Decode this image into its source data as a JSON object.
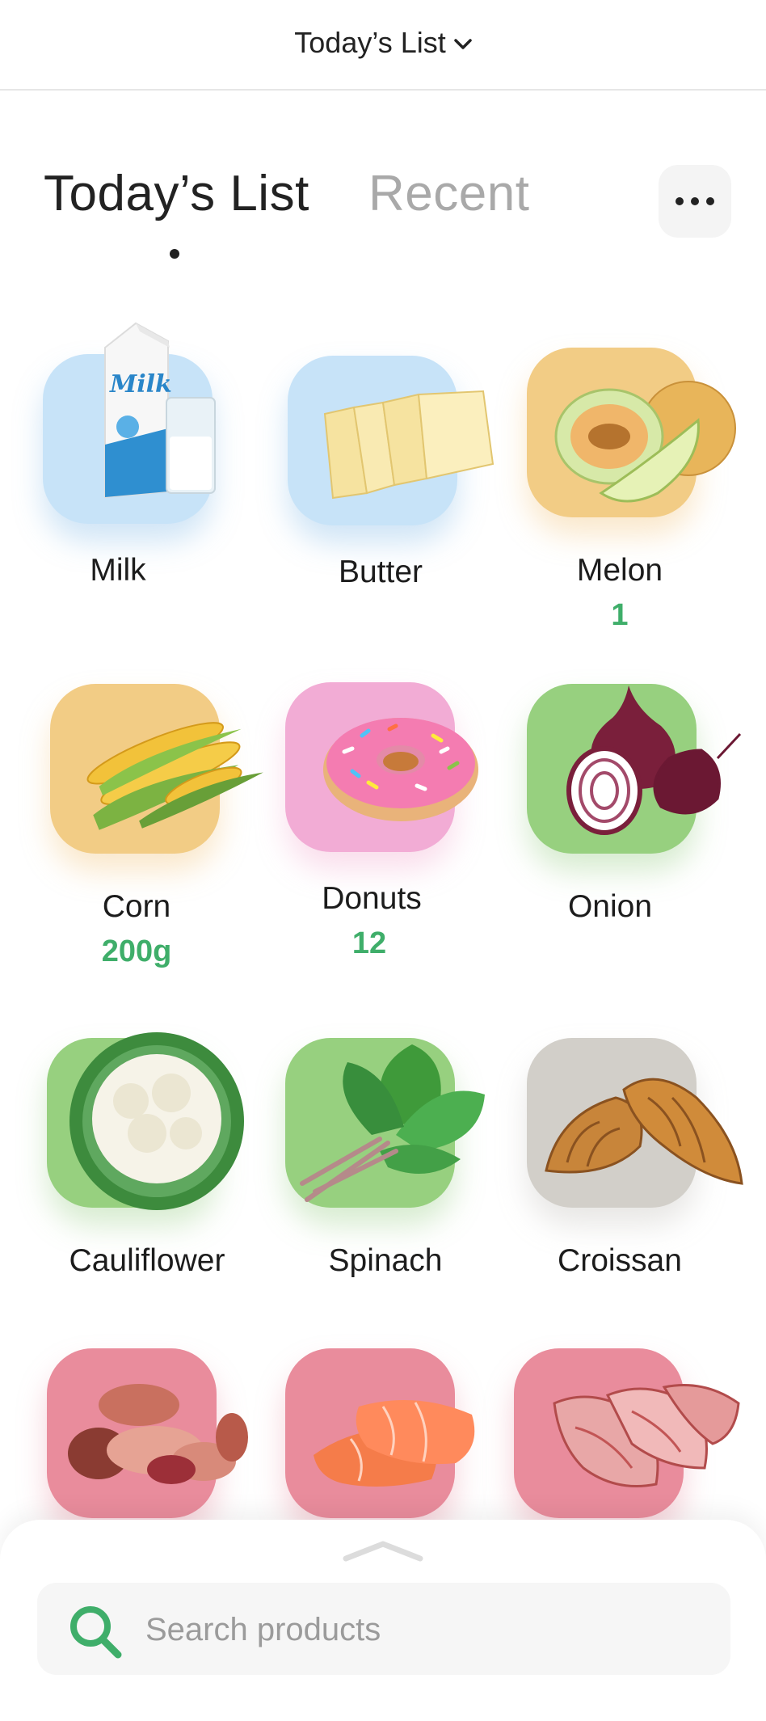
{
  "header": {
    "title": "Today’s List"
  },
  "tabs": [
    {
      "label": "Today’s List",
      "active": true
    },
    {
      "label": "Recent",
      "active": false
    }
  ],
  "items": [
    {
      "name": "Milk",
      "qty": ""
    },
    {
      "name": "Butter",
      "qty": ""
    },
    {
      "name": "Melon",
      "qty": "1"
    },
    {
      "name": "Corn",
      "qty": "200g"
    },
    {
      "name": "Donuts",
      "qty": "12"
    },
    {
      "name": "Onion",
      "qty": ""
    },
    {
      "name": "Cauliflower",
      "qty": ""
    },
    {
      "name": "Spinach",
      "qty": ""
    },
    {
      "name": "Croissan",
      "qty": ""
    },
    {
      "name": "",
      "qty": ""
    },
    {
      "name": "",
      "qty": ""
    },
    {
      "name": "",
      "qty": ""
    }
  ],
  "search": {
    "placeholder": "Search products"
  },
  "icons": {
    "dropdown": "chevron-down-icon",
    "more": "more-options-icon",
    "sheet_handle": "chevron-up-icon",
    "search": "search-icon"
  },
  "colors": {
    "qty": "#3fae6a",
    "search_icon": "#3fae6a"
  }
}
